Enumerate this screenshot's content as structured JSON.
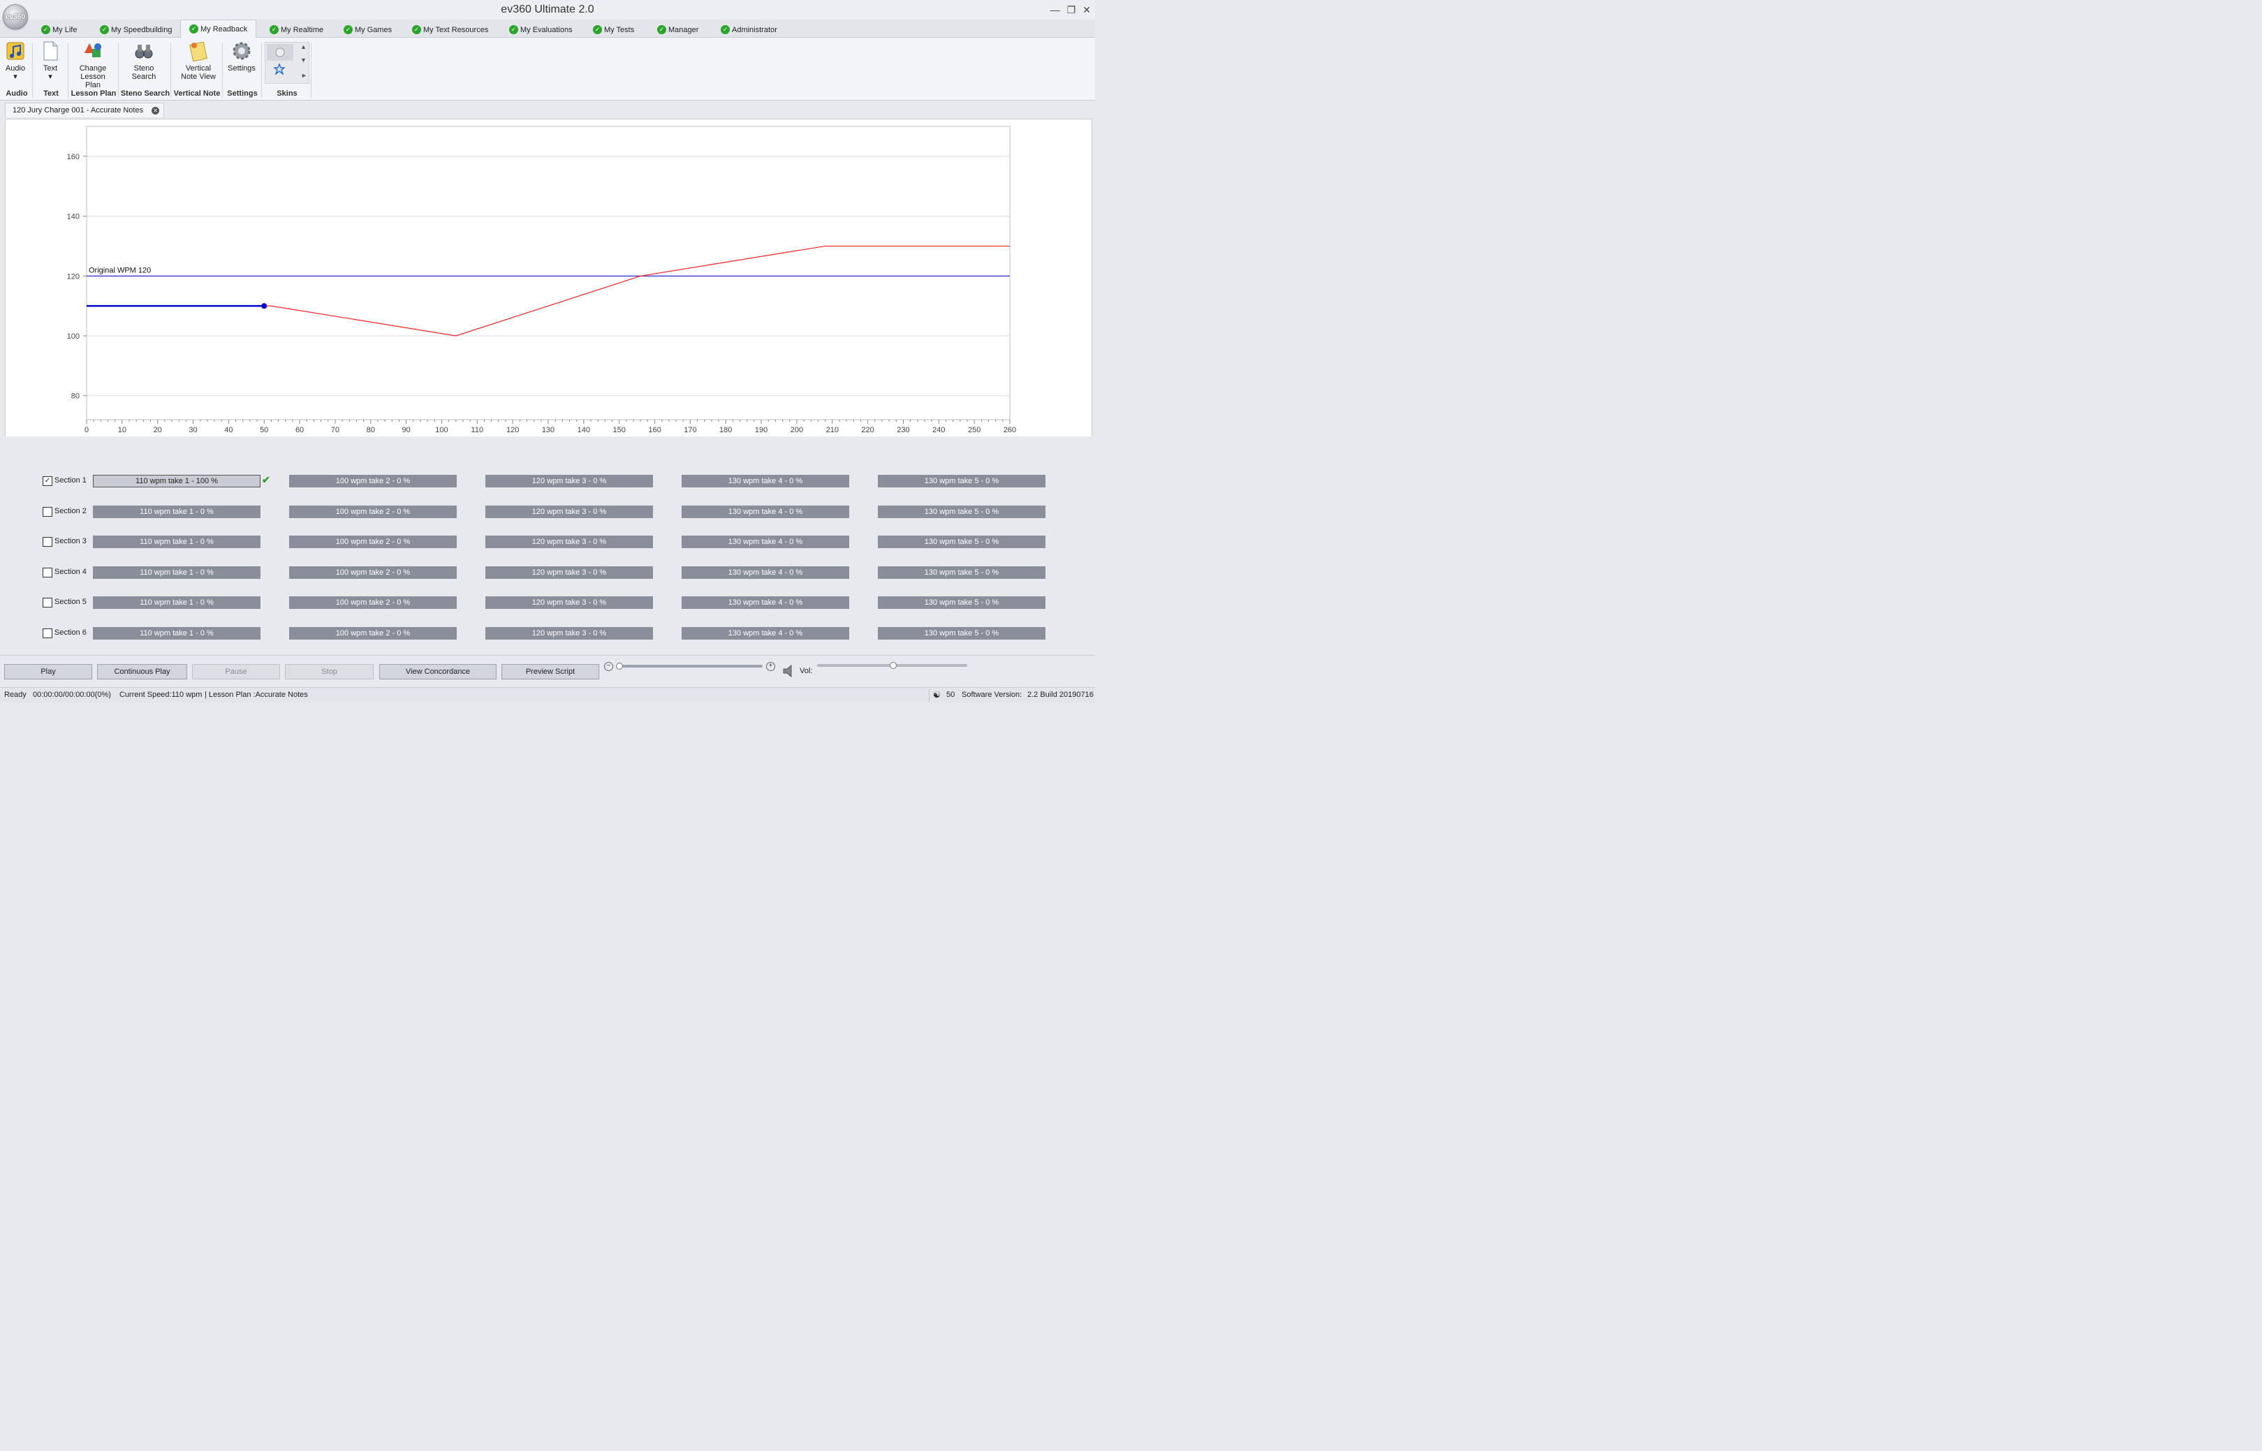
{
  "window": {
    "title": "ev360 Ultimate 2.0",
    "logo": "ev360"
  },
  "tabs": [
    {
      "label": "My Life"
    },
    {
      "label": "My Speedbuilding"
    },
    {
      "label": "My Readback"
    },
    {
      "label": "My Realtime"
    },
    {
      "label": "My Games"
    },
    {
      "label": "My Text Resources"
    },
    {
      "label": "My Evaluations"
    },
    {
      "label": "My Tests"
    },
    {
      "label": "Manager"
    },
    {
      "label": "Administrator"
    }
  ],
  "active_tab": "My Readback",
  "ribbon": {
    "audio": "Audio",
    "text": "Text",
    "change_lesson_1": "Change",
    "change_lesson_2": "Lesson Plan",
    "steno_1": "Steno",
    "steno_2": "Search",
    "vertical_1": "Vertical",
    "vertical_2": "Note View",
    "settings": "Settings",
    "groups": {
      "audio": "Audio",
      "text": "Text",
      "lesson": "Lesson Plan",
      "steno": "Steno Search",
      "vertical": "Vertical Note",
      "settings": "Settings",
      "skins": "Skins"
    }
  },
  "doc_tab": {
    "label": "120 Jury Charge 001 - Accurate Notes"
  },
  "chart_data": {
    "type": "line",
    "title": "",
    "xlabel": "",
    "ylabel": "",
    "xlim": [
      0,
      260
    ],
    "ylim": [
      72,
      170
    ],
    "xticks": [
      0,
      10,
      20,
      30,
      40,
      50,
      60,
      70,
      80,
      90,
      100,
      110,
      120,
      130,
      140,
      150,
      160,
      170,
      180,
      190,
      200,
      210,
      220,
      230,
      240,
      250,
      260
    ],
    "yticks": [
      80,
      100,
      120,
      140,
      160
    ],
    "grid": "horizontal",
    "reference_line": {
      "y": 120,
      "label": "Original WPM 120",
      "color": "#0000cc"
    },
    "series": [
      {
        "color": "#ff2020",
        "points": [
          [
            0,
            110
          ],
          [
            52,
            110
          ],
          [
            104,
            100
          ],
          [
            156,
            120
          ],
          [
            208,
            130
          ],
          [
            260,
            130
          ]
        ]
      }
    ],
    "progress": {
      "color": "#0000cc",
      "points": [
        [
          0,
          110
        ],
        [
          50,
          110
        ]
      ],
      "marker": [
        50,
        110
      ]
    }
  },
  "sections": [
    {
      "label": "Section 1",
      "checked": true,
      "takes": [
        "110 wpm take 1 - 100 %",
        "100 wpm take 2 - 0 %",
        "120 wpm take 3 - 0 %",
        "130 wpm take 4 - 0 %",
        "130 wpm take 5 - 0 %"
      ]
    },
    {
      "label": "Section 2",
      "checked": false,
      "takes": [
        "110 wpm take 1 - 0 %",
        "100 wpm take 2 - 0 %",
        "120 wpm take 3 - 0 %",
        "130 wpm take 4 - 0 %",
        "130 wpm take 5 - 0 %"
      ]
    },
    {
      "label": "Section 3",
      "checked": false,
      "takes": [
        "110 wpm take 1 - 0 %",
        "100 wpm take 2 - 0 %",
        "120 wpm take 3 - 0 %",
        "130 wpm take 4 - 0 %",
        "130 wpm take 5 - 0 %"
      ]
    },
    {
      "label": "Section 4",
      "checked": false,
      "takes": [
        "110 wpm take 1 - 0 %",
        "100 wpm take 2 - 0 %",
        "120 wpm take 3 - 0 %",
        "130 wpm take 4 - 0 %",
        "130 wpm take 5 - 0 %"
      ]
    },
    {
      "label": "Section 5",
      "checked": false,
      "takes": [
        "110 wpm take 1 - 0 %",
        "100 wpm take 2 - 0 %",
        "120 wpm take 3 - 0 %",
        "130 wpm take 4 - 0 %",
        "130 wpm take 5 - 0 %"
      ]
    },
    {
      "label": "Section 6",
      "checked": false,
      "takes": [
        "110 wpm take 1 - 0 %",
        "100 wpm take 2 - 0 %",
        "120 wpm take 3 - 0 %",
        "130 wpm take 4 - 0 %",
        "130 wpm take 5 - 0 %"
      ]
    }
  ],
  "controls": {
    "play": "Play",
    "continuous": "Continuous Play",
    "pause": "Pause",
    "stop": "Stop",
    "concordance": "View Concordance",
    "preview": "Preview  Script",
    "vol": "Vol:"
  },
  "status": {
    "ready": "Ready",
    "time": "00:00:00/00:00:00(0%)",
    "speed": "Current Speed:110 wpm",
    "lesson": "| Lesson Plan :Accurate Notes",
    "count": "50",
    "version_label": "Software Version:",
    "version": "2.2 Build 20190716"
  }
}
